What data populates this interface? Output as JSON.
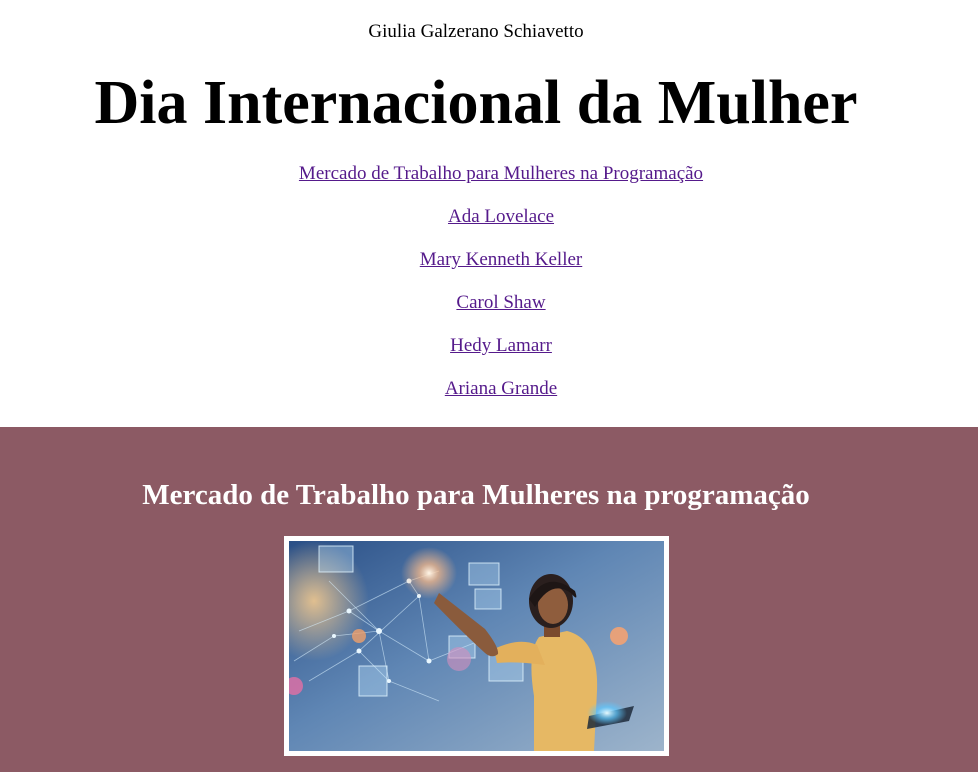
{
  "header": {
    "author": "Giulia Galzerano Schiavetto",
    "title": "Dia Internacional da Mulher"
  },
  "nav": {
    "links": [
      "Mercado de Trabalho para Mulheres na Programação",
      "Ada Lovelace",
      "Mary Kenneth Keller",
      "Carol Shaw",
      "Hedy Lamarr",
      "Ariana Grande"
    ]
  },
  "section": {
    "title": "Mercado de Trabalho para Mulheres na programação",
    "image_icon": "woman-touching-holographic-interface-photo"
  },
  "colors": {
    "link": "#551a8b",
    "section_background": "#8c5a64",
    "section_text": "#ffffff"
  }
}
